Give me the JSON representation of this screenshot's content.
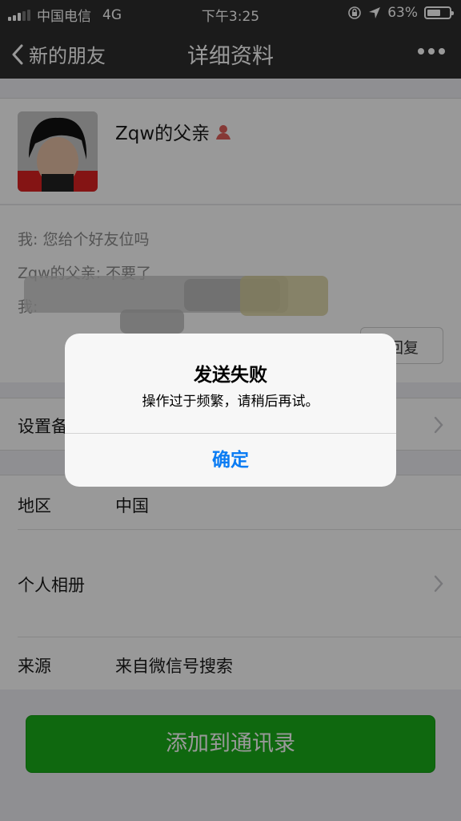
{
  "status_bar": {
    "carrier": "中国电信",
    "network": "4G",
    "time": "下午3:25",
    "battery_percent": "63%",
    "battery_level": 0.63
  },
  "nav": {
    "back_label": "新的朋友",
    "title": "详细资料"
  },
  "profile": {
    "name": "Zqw的父亲",
    "gender_icon": "female-icon"
  },
  "greeting": {
    "line1": "我: 您给个好友位吗",
    "line2": "Zqw的父亲: 不要了",
    "line3": "我:",
    "reply_label": "回复"
  },
  "rows": {
    "remark_label": "设置备",
    "region_label": "地区",
    "region_value": "中国",
    "album_label": "个人相册",
    "source_label": "来源",
    "source_value": "来自微信号搜索"
  },
  "add_button_label": "添加到通讯录",
  "alert": {
    "title": "发送失败",
    "message": "操作过于频繁，请稍后再试。",
    "ok_label": "确定"
  },
  "colors": {
    "nav_bg": "#2e2e2e",
    "button_green": "#1aad19",
    "alert_blue": "#0b7cf3"
  }
}
